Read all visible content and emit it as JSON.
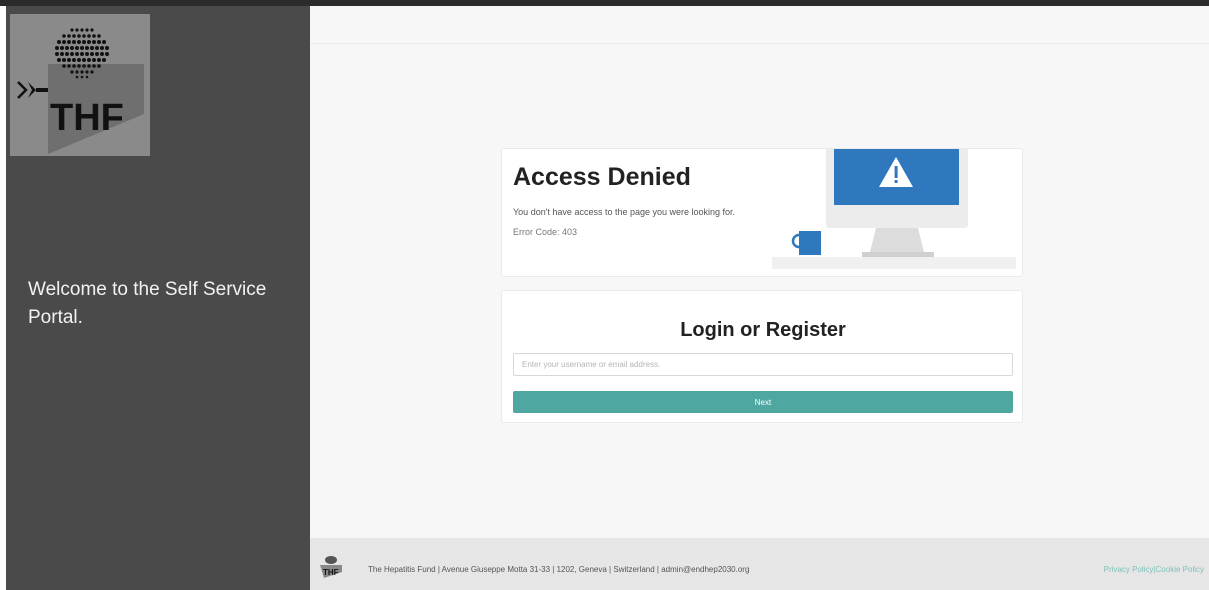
{
  "sidebar": {
    "logo_text": "THF",
    "welcome_text": "Welcome to the Self Service Portal."
  },
  "access_denied": {
    "title": "Access Denied",
    "message": "You don't have access to the page you were looking for.",
    "error_code": "Error Code: 403",
    "illustration_icon": "warning-icon"
  },
  "login": {
    "title": "Login or Register",
    "placeholder": "Enter your username or email address.",
    "value": "",
    "next_label": "Next"
  },
  "footer": {
    "logo_text": "THF",
    "address": "The Hepatitis Fund | Avenue Giuseppe Motta 31-33 | 1202, Geneva | Switzerland | admin@endhep2030.org",
    "privacy_label": "Privacy Policy",
    "separator": "|",
    "cookie_label": "Cookie Policy"
  },
  "colors": {
    "sidebar_bg": "#4a4a4a",
    "accent": "#4fa7a2",
    "monitor_screen": "#2f78bd",
    "link": "#7fc1ba"
  }
}
